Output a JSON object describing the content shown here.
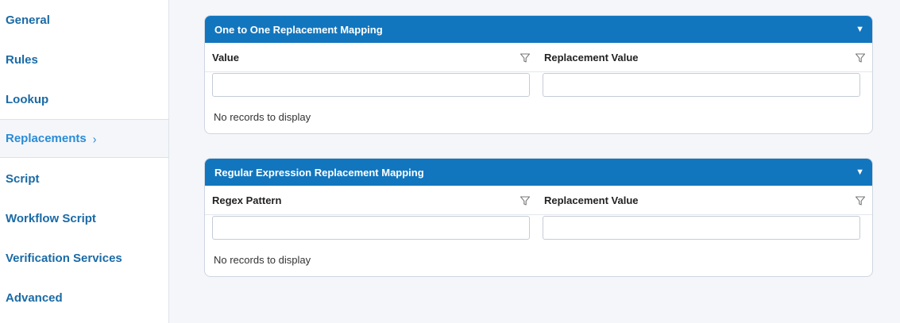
{
  "sidebar": {
    "items": [
      {
        "label": "General"
      },
      {
        "label": "Rules"
      },
      {
        "label": "Lookup"
      },
      {
        "label": "Replacements",
        "active": true
      },
      {
        "label": "Script"
      },
      {
        "label": "Workflow Script"
      },
      {
        "label": "Verification Services"
      },
      {
        "label": "Advanced"
      }
    ],
    "active_indicator": "›"
  },
  "panels": [
    {
      "title": "One to One Replacement Mapping",
      "toggle_icon": "▼",
      "columns": [
        "Value",
        "Replacement Value"
      ],
      "filter_values": [
        "",
        ""
      ],
      "empty_text": "No records to display"
    },
    {
      "title": "Regular Expression Replacement Mapping",
      "toggle_icon": "▼",
      "columns": [
        "Regex Pattern",
        "Replacement Value"
      ],
      "filter_values": [
        "",
        ""
      ],
      "empty_text": "No records to display"
    }
  ],
  "colors": {
    "accent": "#1276be",
    "nav_text": "#1a6aa6",
    "nav_active": "#2a8bd6",
    "background": "#f4f6fa"
  }
}
